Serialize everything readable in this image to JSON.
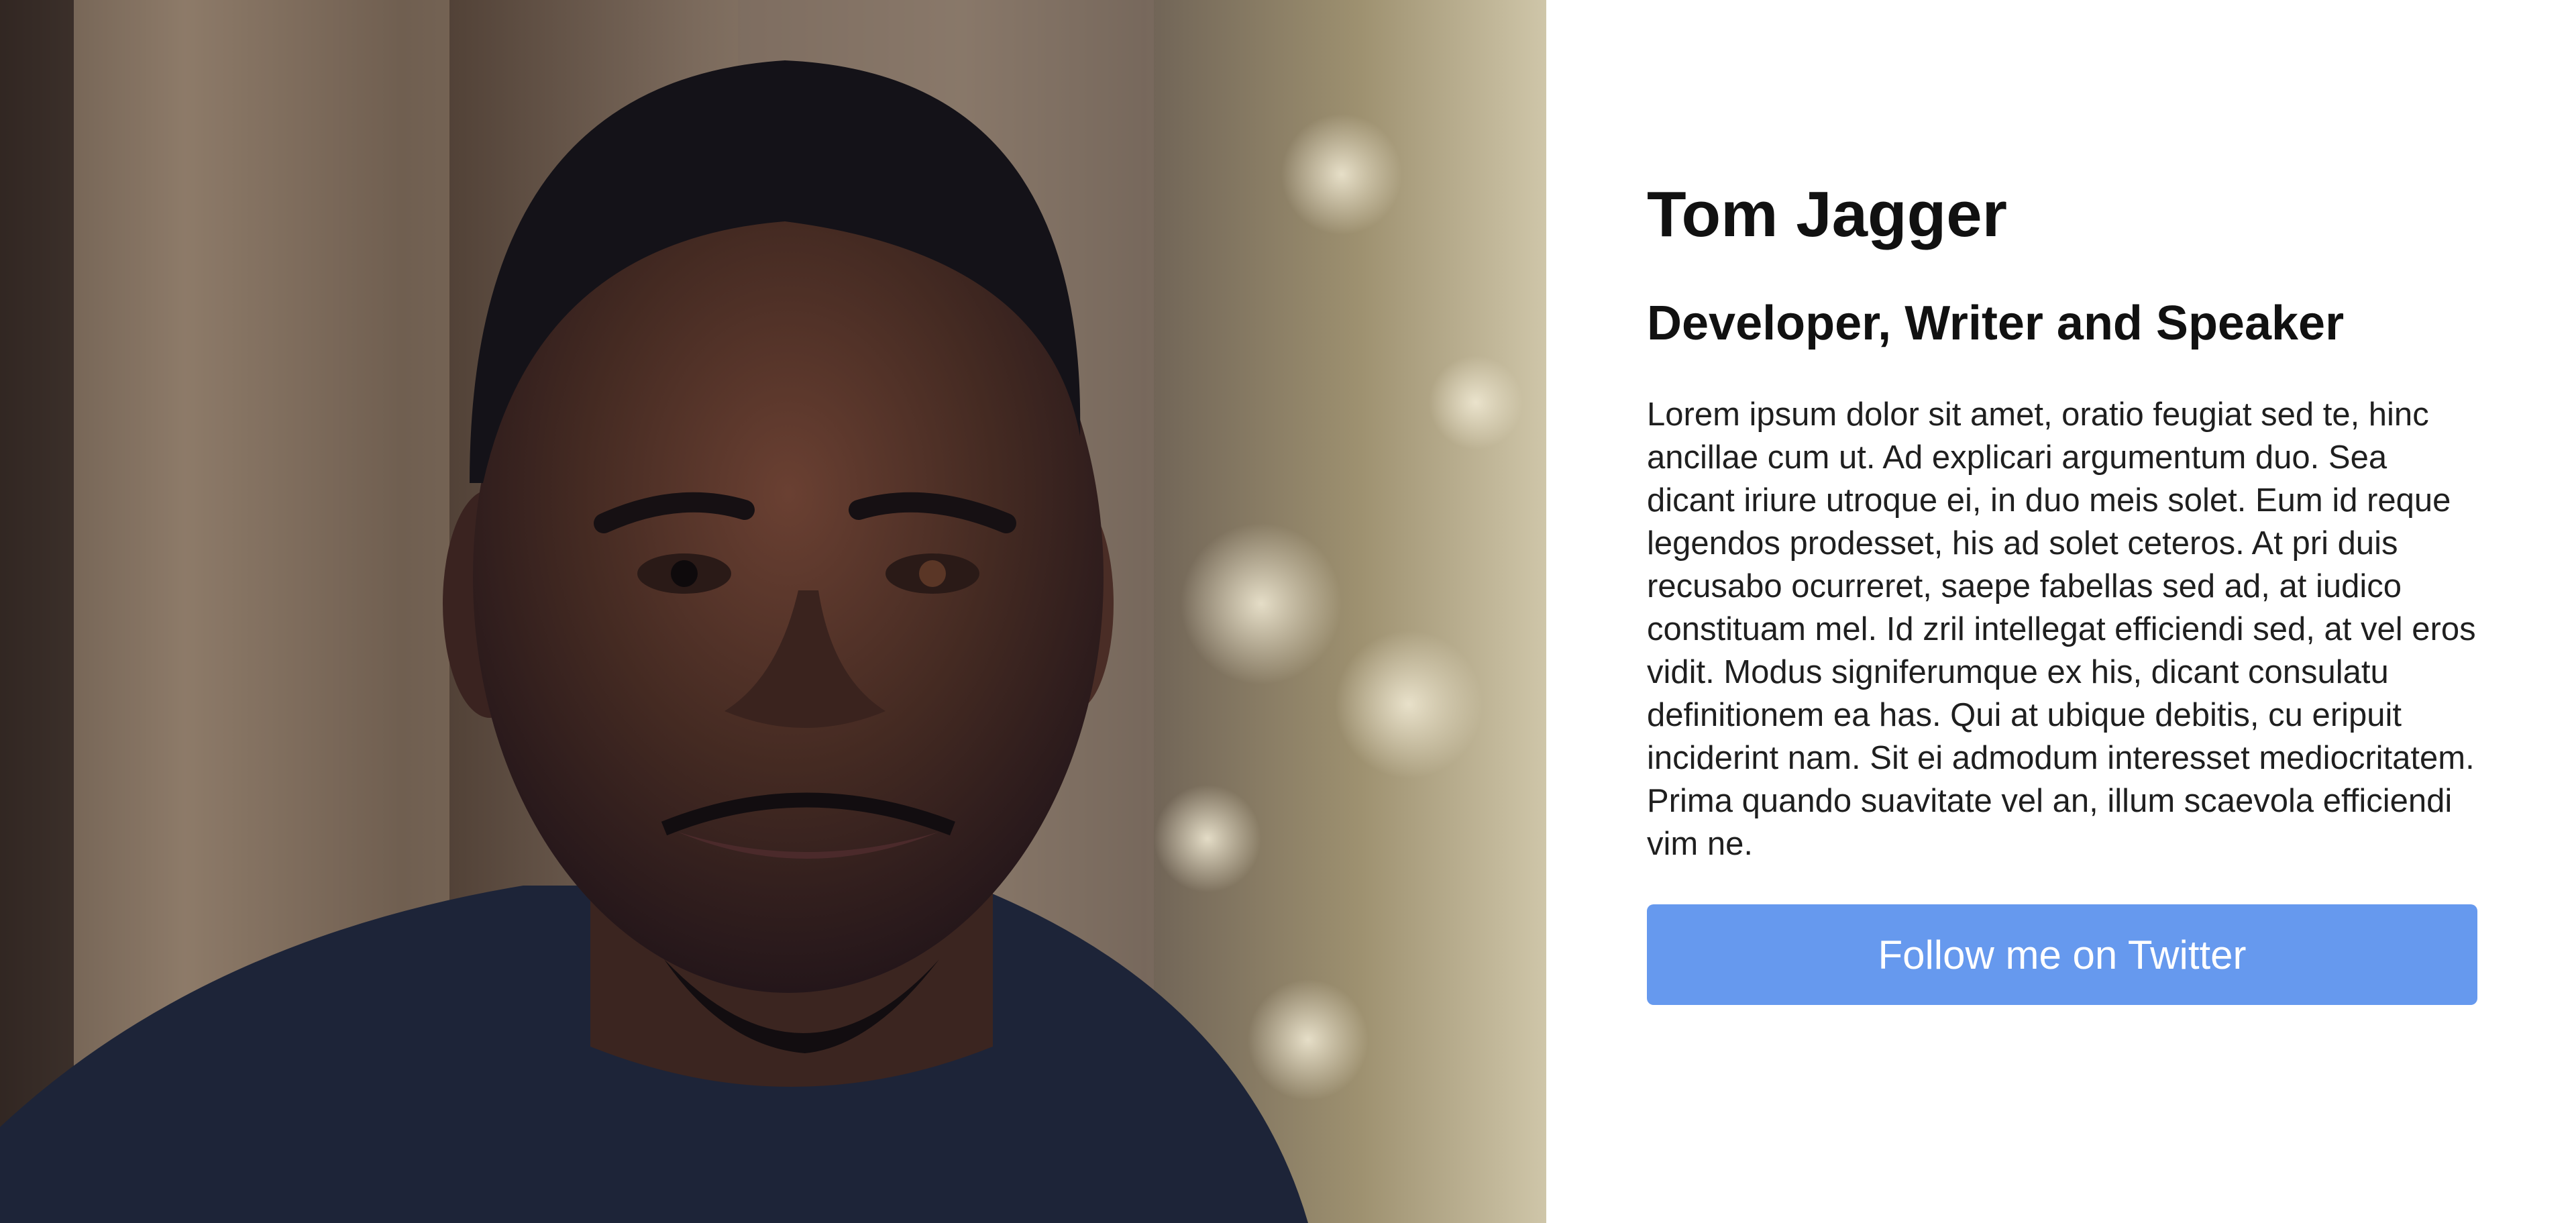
{
  "profile": {
    "name": "Tom Jagger",
    "headline": "Developer, Writer and Speaker",
    "bio": "Lorem ipsum dolor sit amet, oratio feugiat sed te, hinc ancillae cum ut. Ad explicari argumentum duo. Sea dicant iriure utroque ei, in duo meis solet. Eum id reque legendos prodesset, his ad solet ceteros. At pri duis recusabo ocurreret, saepe fabellas sed ad, at iudico constituam mel. Id zril intellegat efficiendi sed, at vel eros vidit. Modus signiferumque ex his, dicant consulatu definitionem ea has. Qui at ubique debitis, cu eripuit inciderint nam. Sit ei admodum interesset mediocritatem. Prima quando suavitate vel an, illum scaevola efficiendi vim ne.",
    "follow_button_label": "Follow me on Twitter"
  },
  "colors": {
    "button_background": "#6699ee",
    "button_text": "#ffffff",
    "text": "#111111",
    "page_background": "#ffffff"
  }
}
